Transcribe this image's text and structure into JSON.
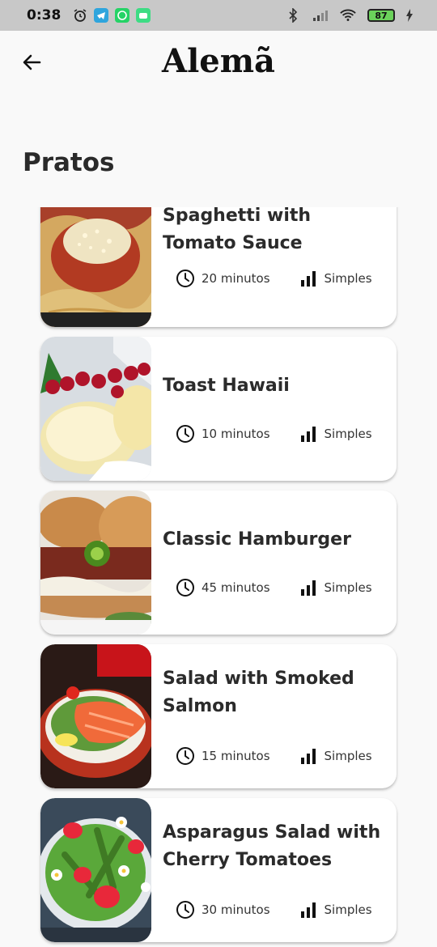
{
  "status_bar": {
    "time": "0:38",
    "battery": "87"
  },
  "app_bar": {
    "title": "Alemã"
  },
  "section": {
    "title": "Pratos"
  },
  "dishes": [
    {
      "name": "Spaghetti with Tomato Sauce",
      "duration": "20 minutos",
      "complexity": "Simples"
    },
    {
      "name": "Toast Hawaii",
      "duration": "10 minutos",
      "complexity": "Simples"
    },
    {
      "name": "Classic Hamburger",
      "duration": "45 minutos",
      "complexity": "Simples"
    },
    {
      "name": "Salad with Smoked Salmon",
      "duration": "15 minutos",
      "complexity": "Simples"
    },
    {
      "name": "Asparagus Salad with Cherry Tomatoes",
      "duration": "30 minutos",
      "complexity": "Simples"
    }
  ],
  "icons": {
    "back": "arrow-back-icon",
    "clock": "clock-icon",
    "complexity": "signal-bars-icon"
  }
}
